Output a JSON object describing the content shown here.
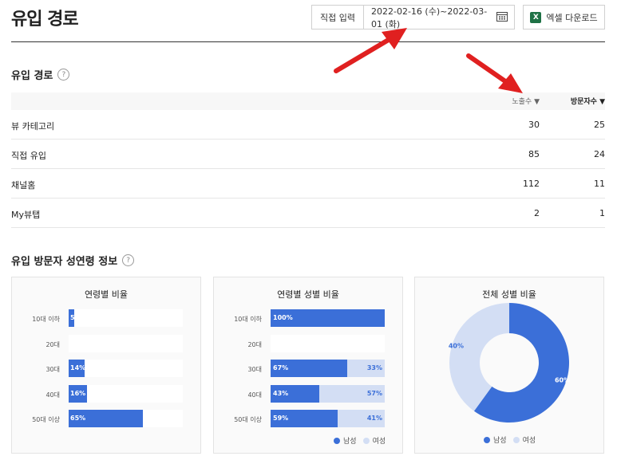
{
  "header": {
    "title": "유입 경로",
    "direct_input_label": "직접 입력",
    "date_range": "2022-02-16 (수)~2022-03-01 (화)",
    "excel_label": "엑셀 다운로드",
    "excel_icon_letter": "X"
  },
  "inflow": {
    "title": "유입 경로",
    "help": "?",
    "columns": {
      "impressions": "노출수 ▼",
      "visitors": "방문자수 ▼"
    },
    "rows": [
      {
        "label": "뷰 카테고리",
        "impressions": "30",
        "visitors": "25"
      },
      {
        "label": "직접 유입",
        "impressions": "85",
        "visitors": "24"
      },
      {
        "label": "채널홈",
        "impressions": "112",
        "visitors": "11"
      },
      {
        "label": "My뷰탭",
        "impressions": "2",
        "visitors": "1"
      }
    ]
  },
  "demo": {
    "title": "유입 방문자 성연령 정보",
    "help": "?",
    "legend": {
      "male": "남성",
      "female": "여성"
    }
  },
  "colors": {
    "male": "#3b6fd8",
    "female": "#d3def4",
    "arrow": "#e02020"
  },
  "chart_data": [
    {
      "type": "bar",
      "title": "연령별 비율",
      "categories": [
        "10대 이하",
        "20대",
        "30대",
        "40대",
        "50대 이상"
      ],
      "values": [
        5,
        0,
        14,
        16,
        65
      ],
      "labels": [
        "5",
        "",
        "14%",
        "16%",
        "65%"
      ],
      "xlim": [
        0,
        100
      ]
    },
    {
      "type": "bar",
      "stacked": true,
      "title": "연령별 성별 비율",
      "categories": [
        "10대 이하",
        "20대",
        "30대",
        "40대",
        "50대 이상"
      ],
      "series": [
        {
          "name": "남성",
          "values": [
            100,
            0,
            67,
            43,
            59
          ],
          "labels": [
            "100%",
            "",
            "67%",
            "43%",
            "59%"
          ]
        },
        {
          "name": "여성",
          "values": [
            0,
            0,
            33,
            57,
            41
          ],
          "labels": [
            "",
            "",
            "33%",
            "57%",
            "41%"
          ]
        }
      ],
      "xlim": [
        0,
        100
      ]
    },
    {
      "type": "pie",
      "donut": true,
      "title": "전체 성별 비율",
      "categories": [
        "남성",
        "여성"
      ],
      "values": [
        60,
        40
      ],
      "labels": [
        "60%",
        "40%"
      ]
    }
  ]
}
